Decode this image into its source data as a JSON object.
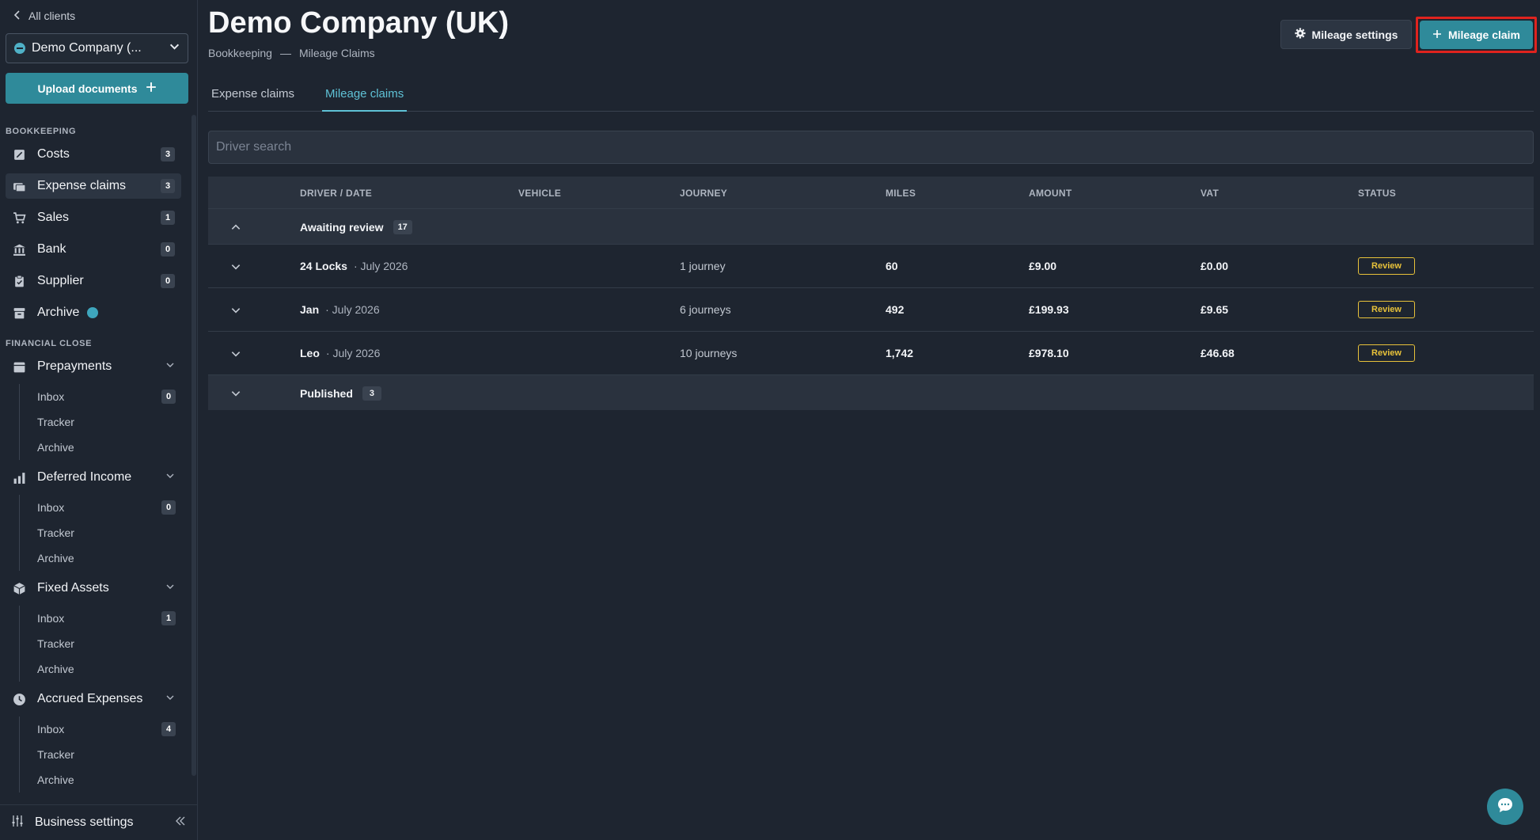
{
  "sidebar": {
    "back_label": "All clients",
    "client_name": "Demo Company (...",
    "upload_label": "Upload documents",
    "bookkeeping_label": "BOOKKEEPING",
    "financial_close_label": "FINANCIAL CLOSE",
    "items": [
      {
        "label": "Costs",
        "count": "3"
      },
      {
        "label": "Expense claims",
        "count": "3"
      },
      {
        "label": "Sales",
        "count": "1"
      },
      {
        "label": "Bank",
        "count": "0"
      },
      {
        "label": "Supplier",
        "count": "0"
      },
      {
        "label": "Archive"
      }
    ],
    "groups": [
      {
        "label": "Prepayments",
        "inbox": "Inbox",
        "inbox_count": "0",
        "tracker": "Tracker",
        "archive": "Archive"
      },
      {
        "label": "Deferred Income",
        "inbox": "Inbox",
        "inbox_count": "0",
        "tracker": "Tracker",
        "archive": "Archive"
      },
      {
        "label": "Fixed Assets",
        "inbox": "Inbox",
        "inbox_count": "1",
        "tracker": "Tracker",
        "archive": "Archive"
      },
      {
        "label": "Accrued Expenses",
        "inbox": "Inbox",
        "inbox_count": "4",
        "tracker": "Tracker",
        "archive": "Archive"
      }
    ],
    "business_settings": "Business settings"
  },
  "header": {
    "title": "Demo Company (UK)",
    "breadcrumb_1": "Bookkeeping",
    "breadcrumb_sep": "—",
    "breadcrumb_2": "Mileage Claims",
    "settings_label": "Mileage settings",
    "claim_label": "Mileage claim"
  },
  "tabs": [
    {
      "label": "Expense claims"
    },
    {
      "label": "Mileage claims",
      "active": true
    }
  ],
  "search": {
    "placeholder": "Driver search"
  },
  "table": {
    "columns": [
      "DRIVER / DATE",
      "VEHICLE",
      "JOURNEY",
      "MILES",
      "AMOUNT",
      "VAT",
      "STATUS"
    ],
    "groups": [
      {
        "title": "Awaiting review",
        "count": "17",
        "rows": [
          {
            "driver": "24 Locks",
            "date": "· July 2026",
            "vehicle": "",
            "journey": "1 journey",
            "miles": "60",
            "amount": "£9.00",
            "vat": "£0.00",
            "status": "Review"
          },
          {
            "driver": "Jan",
            "date": "· July 2026",
            "vehicle": "",
            "journey": "6 journeys",
            "miles": "492",
            "amount": "£199.93",
            "vat": "£9.65",
            "status": "Review"
          },
          {
            "driver": "Leo",
            "date": "· July 2026",
            "vehicle": "",
            "journey": "10 journeys",
            "miles": "1,742",
            "amount": "£978.10",
            "vat": "£46.68",
            "status": "Review"
          }
        ]
      },
      {
        "title": "Published",
        "count": "3"
      }
    ]
  },
  "colors": {
    "accent": "#2f8a9a",
    "tab_active": "#5fc2d6",
    "review": "#e8c23a",
    "highlight": "#e0231e"
  }
}
